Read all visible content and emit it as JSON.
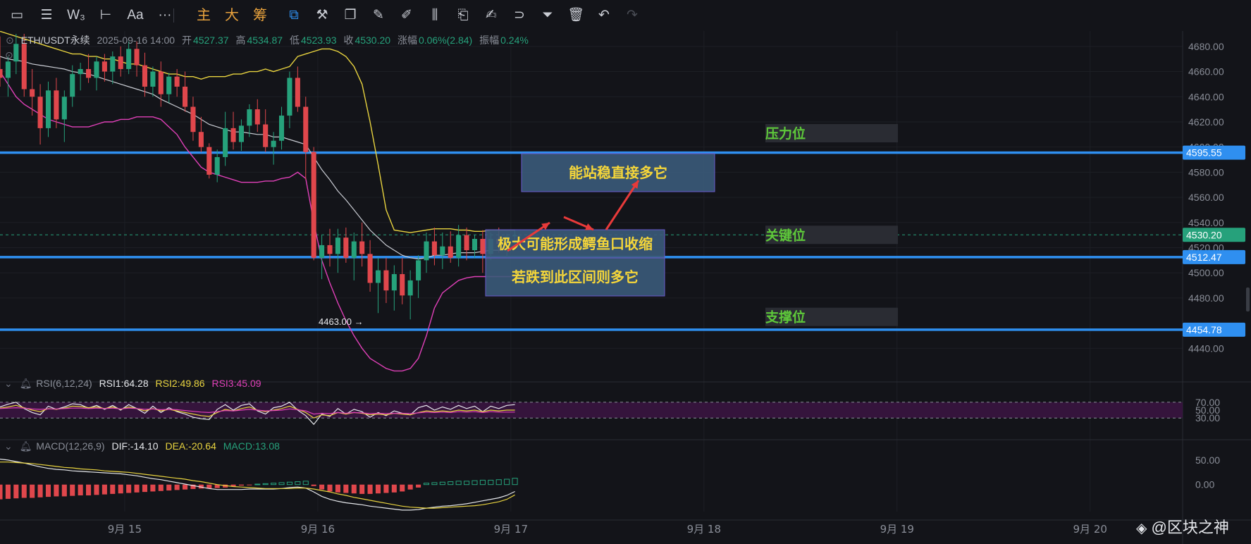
{
  "toolbar": {
    "tools_left": [
      {
        "icon": "rectangle-icon",
        "glyph": "▭"
      },
      {
        "icon": "lines-icon",
        "glyph": "☰"
      },
      {
        "icon": "wave-icon",
        "glyph": "W₃"
      },
      {
        "icon": "horizontal-line-icon",
        "glyph": "⊢"
      },
      {
        "icon": "font-icon",
        "glyph": "Aa"
      },
      {
        "icon": "more-icon",
        "glyph": "···"
      }
    ],
    "tabs": [
      "主",
      "大",
      "筹"
    ],
    "tools_right": [
      {
        "icon": "indicator-edit-icon",
        "glyph": "⧉"
      },
      {
        "icon": "tools-icon",
        "glyph": "⚒"
      },
      {
        "icon": "copy-icon",
        "glyph": "❐"
      },
      {
        "icon": "ruler-icon",
        "glyph": "✎"
      },
      {
        "icon": "pen-icon",
        "glyph": "✐"
      },
      {
        "icon": "candles-icon",
        "glyph": "⫼"
      },
      {
        "icon": "clipboard-icon",
        "glyph": "⎗"
      },
      {
        "icon": "note-icon",
        "glyph": "✍"
      },
      {
        "icon": "magnet-icon",
        "glyph": "⊃"
      },
      {
        "icon": "filter-icon",
        "glyph": "⏷"
      },
      {
        "icon": "trash-icon",
        "glyph": "🗑"
      },
      {
        "icon": "undo-icon",
        "glyph": "↶"
      },
      {
        "icon": "redo-icon",
        "glyph": "↷"
      }
    ]
  },
  "ohlc_line": {
    "symbol": "ETH/USDT永续",
    "datetime": "2025-09-16 14:00",
    "open_label": "开",
    "open": "4527.37",
    "high_label": "高",
    "high": "4534.87",
    "low_label": "低",
    "low": "4523.93",
    "close_label": "收",
    "close": "4530.20",
    "change_label": "涨幅",
    "change": "0.06%(2.84)",
    "amp_label": "振幅",
    "amp": "0.24%"
  },
  "rsi_line": {
    "name": "RSI(6,12,24)",
    "rsi1": "RSI1:64.28",
    "rsi2": "RSI2:49.86",
    "rsi3": "RSI3:45.09"
  },
  "macd_line": {
    "name": "MACD(12,26,9)",
    "dif": "DIF:-14.10",
    "dea": "DEA:-20.64",
    "macd": "MACD:13.08"
  },
  "annotations": {
    "pressure": "压力位",
    "key": "关键位",
    "support": "支撑位",
    "box_top": "能站稳直接多它",
    "box_mid": "极大可能形成鳄鱼口收缩",
    "box_bottom": "若跌到此区间则多它",
    "low_marker": "4463.00 →"
  },
  "watermark": "@区块之神",
  "colors": {
    "background": "#131419",
    "up": "#26a17b",
    "down": "#e0474c",
    "level_line": "#2f8ff0",
    "boll_upper": "#e8d33f",
    "boll_mid": "#c9ccd3",
    "boll_lower": "#e040b8",
    "note_box": "#3b5a7a",
    "note_text": "#f5d63a",
    "level_text": "#5ec93a"
  },
  "chart_data": {
    "type": "candlestick",
    "symbol": "ETH/USDT永续",
    "interval_hint": "1h",
    "ylim": [
      4420,
      4690
    ],
    "y_ticks": [
      "4680.00",
      "4660.00",
      "4640.00",
      "4620.00",
      "4600.00",
      "4580.00",
      "4560.00",
      "4540.00",
      "4520.00",
      "4500.00",
      "4480.00",
      "4440.00"
    ],
    "x_ticks": [
      "9月 15",
      "9月 16",
      "9月 17",
      "9月 18",
      "9月 19",
      "9月 20"
    ],
    "price_tags": [
      {
        "label": "4595.55",
        "value": 4595.55
      },
      {
        "label": "4530.20",
        "value": 4530.2
      },
      {
        "label": "4512.47",
        "value": 4512.47
      },
      {
        "label": "4454.78",
        "value": 4454.78
      }
    ],
    "last_price": 4530.2,
    "ohlc": [
      [
        4662,
        4688,
        4648,
        4655
      ],
      [
        4655,
        4672,
        4640,
        4668
      ],
      [
        4668,
        4690,
        4658,
        4682
      ],
      [
        4682,
        4690,
        4640,
        4646
      ],
      [
        4646,
        4662,
        4625,
        4640
      ],
      [
        4640,
        4650,
        4602,
        4615
      ],
      [
        4615,
        4652,
        4608,
        4645
      ],
      [
        4645,
        4655,
        4615,
        4622
      ],
      [
        4622,
        4645,
        4604,
        4640
      ],
      [
        4640,
        4665,
        4632,
        4658
      ],
      [
        4658,
        4667,
        4645,
        4662
      ],
      [
        4662,
        4674,
        4651,
        4655
      ],
      [
        4655,
        4672,
        4645,
        4668
      ],
      [
        4668,
        4674,
        4652,
        4660
      ],
      [
        4660,
        4676,
        4650,
        4672
      ],
      [
        4672,
        4680,
        4656,
        4662
      ],
      [
        4662,
        4684,
        4658,
        4678
      ],
      [
        4678,
        4684,
        4656,
        4665
      ],
      [
        4665,
        4675,
        4640,
        4648
      ],
      [
        4648,
        4664,
        4640,
        4660
      ],
      [
        4660,
        4668,
        4632,
        4642
      ],
      [
        4642,
        4659,
        4635,
        4656
      ],
      [
        4656,
        4662,
        4640,
        4648
      ],
      [
        4648,
        4660,
        4628,
        4632
      ],
      [
        4632,
        4640,
        4605,
        4612
      ],
      [
        4612,
        4624,
        4596,
        4600
      ],
      [
        4600,
        4603,
        4575,
        4578
      ],
      [
        4578,
        4598,
        4572,
        4592
      ],
      [
        4592,
        4628,
        4585,
        4615
      ],
      [
        4615,
        4628,
        4598,
        4604
      ],
      [
        4604,
        4622,
        4597,
        4617
      ],
      [
        4617,
        4634,
        4608,
        4630
      ],
      [
        4630,
        4638,
        4612,
        4618
      ],
      [
        4618,
        4630,
        4596,
        4600
      ],
      [
        4600,
        4612,
        4586,
        4605
      ],
      [
        4605,
        4632,
        4598,
        4625
      ],
      [
        4625,
        4660,
        4615,
        4655
      ],
      [
        4655,
        4664,
        4628,
        4632
      ],
      [
        4632,
        4640,
        4574,
        4596
      ],
      [
        4596,
        4600,
        4510,
        4512
      ],
      [
        4512,
        4530,
        4495,
        4522
      ],
      [
        4522,
        4535,
        4505,
        4515
      ],
      [
        4515,
        4535,
        4500,
        4528
      ],
      [
        4528,
        4536,
        4508,
        4512
      ],
      [
        4512,
        4532,
        4494,
        4525
      ],
      [
        4525,
        4540,
        4505,
        4515
      ],
      [
        4515,
        4526,
        4485,
        4492
      ],
      [
        4492,
        4512,
        4468,
        4502
      ],
      [
        4502,
        4512,
        4476,
        4486
      ],
      [
        4486,
        4506,
        4470,
        4499
      ],
      [
        4499,
        4512,
        4475,
        4482
      ],
      [
        4482,
        4502,
        4463,
        4494
      ],
      [
        4494,
        4514,
        4480,
        4510
      ],
      [
        4510,
        4532,
        4500,
        4525
      ],
      [
        4525,
        4536,
        4506,
        4514
      ],
      [
        4514,
        4532,
        4503,
        4521
      ],
      [
        4521,
        4533,
        4508,
        4512
      ],
      [
        4512,
        4538,
        4505,
        4530
      ],
      [
        4530,
        4536,
        4510,
        4518
      ],
      [
        4518,
        4530,
        4512,
        4527
      ],
      [
        4527,
        4534,
        4500,
        4515
      ],
      [
        4515,
        4532,
        4510,
        4527
      ],
      [
        4527,
        4536,
        4516,
        4523
      ],
      [
        4523,
        4531,
        4512,
        4529
      ],
      [
        4529,
        4534,
        4523,
        4530
      ]
    ],
    "x_tick_index": [
      15.5,
      39.5,
      63.5,
      87.5,
      111.5,
      135.5
    ],
    "ylim_index": [
      0,
      147
    ],
    "boll_upper": [
      4692,
      4690,
      4688,
      4686,
      4684,
      4682,
      4680,
      4678,
      4676,
      4674,
      4674,
      4672,
      4672,
      4670,
      4670,
      4668,
      4666,
      4666,
      4664,
      4662,
      4660,
      4658,
      4658,
      4656,
      4656,
      4654,
      4656,
      4656,
      4656,
      4658,
      4658,
      4660,
      4660,
      4662,
      4660,
      4662,
      4664,
      4672,
      4674,
      4676,
      4678,
      4678,
      4676,
      4672,
      4664,
      4650,
      4620,
      4586,
      4550,
      4534,
      4533,
      4532,
      4533,
      4534,
      4535,
      4535,
      4535,
      4534,
      4534,
      4533,
      4533,
      4534,
      4534,
      4534,
      4534
    ],
    "boll_mid": [
      4672,
      4670,
      4669,
      4668,
      4666,
      4665,
      4664,
      4663,
      4662,
      4660,
      4659,
      4658,
      4656,
      4654,
      4652,
      4650,
      4648,
      4646,
      4644,
      4642,
      4638,
      4635,
      4632,
      4629,
      4626,
      4622,
      4618,
      4616,
      4614,
      4612,
      4612,
      4611,
      4610,
      4610,
      4608,
      4608,
      4606,
      4604,
      4602,
      4592,
      4582,
      4574,
      4565,
      4558,
      4550,
      4542,
      4534,
      4528,
      4522,
      4518,
      4514,
      4512,
      4511,
      4512,
      4514,
      4514,
      4515,
      4516,
      4516,
      4516,
      4517,
      4518,
      4518,
      4519,
      4520
    ],
    "boll_lower": [
      4660,
      4650,
      4640,
      4634,
      4630,
      4626,
      4622,
      4620,
      4618,
      4616,
      4616,
      4616,
      4618,
      4620,
      4620,
      4622,
      4622,
      4624,
      4624,
      4624,
      4622,
      4616,
      4610,
      4600,
      4592,
      4584,
      4580,
      4578,
      4576,
      4574,
      4572,
      4572,
      4572,
      4573,
      4573,
      4575,
      4576,
      4580,
      4575,
      4540,
      4510,
      4492,
      4476,
      4462,
      4450,
      4440,
      4432,
      4428,
      4424,
      4422,
      4422,
      4424,
      4432,
      4450,
      4472,
      4484,
      4489,
      4494,
      4496,
      4497,
      4497,
      4497,
      4497,
      4497,
      4497
    ],
    "rsi": {
      "ylim": [
        0,
        100
      ],
      "ticks": [
        "70.00",
        "50.00",
        "30.00"
      ],
      "band": [
        30,
        70
      ],
      "rsi1": [
        58,
        65,
        70,
        54,
        44,
        38,
        60,
        52,
        58,
        66,
        64,
        55,
        62,
        52,
        62,
        50,
        64,
        54,
        42,
        60,
        44,
        56,
        46,
        40,
        32,
        28,
        26,
        52,
        64,
        50,
        62,
        66,
        48,
        40,
        56,
        60,
        70,
        50,
        36,
        14,
        40,
        34,
        54,
        40,
        52,
        46,
        32,
        44,
        36,
        48,
        42,
        38,
        56,
        62,
        50,
        58,
        52,
        62,
        54,
        60,
        46,
        60,
        54,
        62,
        64
      ],
      "rsi2": [
        55,
        58,
        62,
        56,
        50,
        46,
        54,
        52,
        55,
        60,
        59,
        56,
        58,
        54,
        58,
        52,
        58,
        54,
        48,
        54,
        48,
        52,
        48,
        44,
        40,
        36,
        34,
        44,
        52,
        48,
        54,
        58,
        50,
        46,
        50,
        54,
        60,
        52,
        44,
        30,
        38,
        36,
        44,
        40,
        44,
        42,
        38,
        40,
        38,
        42,
        40,
        38,
        44,
        48,
        46,
        48,
        46,
        50,
        48,
        50,
        46,
        50,
        48,
        50,
        50
      ],
      "rsi3": [
        54,
        55,
        56,
        55,
        53,
        52,
        53,
        53,
        54,
        55,
        55,
        54,
        55,
        54,
        55,
        53,
        55,
        54,
        52,
        53,
        51,
        52,
        51,
        49,
        47,
        45,
        44,
        46,
        49,
        48,
        50,
        52,
        50,
        48,
        49,
        50,
        53,
        51,
        48,
        40,
        42,
        41,
        44,
        42,
        44,
        43,
        41,
        42,
        41,
        42,
        42,
        41,
        43,
        45,
        44,
        45,
        44,
        46,
        45,
        46,
        44,
        46,
        45,
        45,
        45
      ]
    },
    "macd": {
      "ylim": [
        -55,
        80
      ],
      "ticks": [
        "50.00",
        "0.00"
      ],
      "dif": [
        52,
        50,
        47,
        44,
        40,
        36,
        33,
        31,
        30,
        28,
        27,
        26,
        25,
        24,
        23,
        22,
        20,
        18,
        15,
        12,
        10,
        7,
        4,
        1,
        -2,
        -5,
        -8,
        -10,
        -10,
        -10,
        -10,
        -9,
        -9,
        -9,
        -9,
        -8,
        -6,
        -5,
        -7,
        -15,
        -24,
        -30,
        -34,
        -37,
        -39,
        -41,
        -44,
        -46,
        -48,
        -50,
        -52,
        -52,
        -51,
        -48,
        -46,
        -44,
        -43,
        -41,
        -39,
        -36,
        -33,
        -30,
        -27,
        -22,
        -14
      ],
      "dea": [
        46,
        46,
        45,
        44,
        43,
        41,
        39,
        37,
        35,
        34,
        32,
        31,
        30,
        28,
        27,
        26,
        25,
        23,
        21,
        19,
        17,
        15,
        13,
        11,
        8,
        6,
        3,
        0,
        -2,
        -4,
        -5,
        -6,
        -7,
        -8,
        -8,
        -8,
        -8,
        -7,
        -7,
        -9,
        -12,
        -15,
        -19,
        -22,
        -26,
        -29,
        -32,
        -35,
        -38,
        -41,
        -44,
        -46,
        -47,
        -48,
        -48,
        -47,
        -46,
        -45,
        -44,
        -43,
        -41,
        -38,
        -35,
        -30,
        -21
      ],
      "hist": [
        -30,
        -29,
        -28,
        -27,
        -27,
        -26,
        -25,
        -24,
        -24,
        -23,
        -22,
        -22,
        -21,
        -20,
        -19,
        -18,
        -17,
        -16,
        -15,
        -14,
        -13,
        -12,
        -11,
        -10,
        -9,
        -8,
        -8,
        -7,
        -6,
        -4,
        -2,
        -1,
        1,
        2,
        3,
        4,
        5,
        6,
        7,
        -3,
        -10,
        -14,
        -16,
        -17,
        -18,
        -19,
        -19,
        -18,
        -17,
        -16,
        -14,
        -10,
        -6,
        3,
        4,
        5,
        6,
        7,
        7,
        8,
        9,
        9,
        10,
        11,
        13
      ]
    }
  }
}
